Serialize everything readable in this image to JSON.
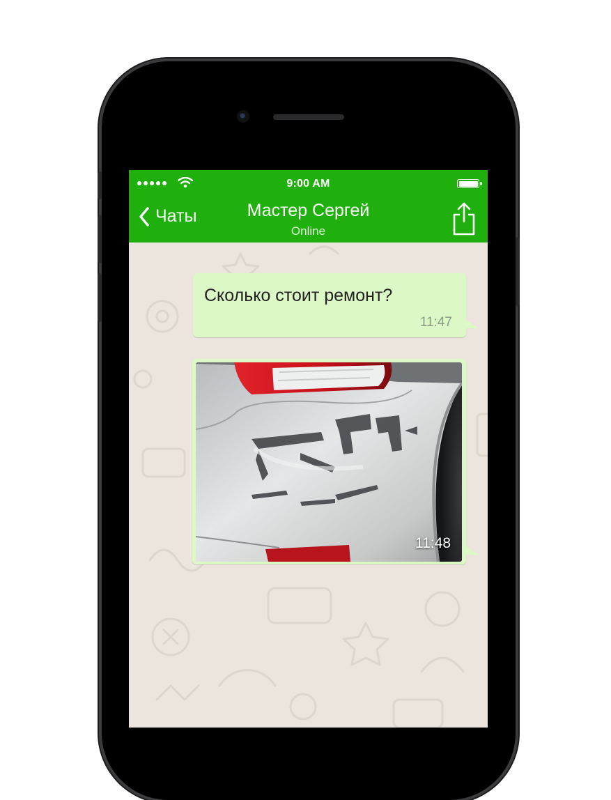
{
  "status_bar": {
    "time": "9:00 AM",
    "signal_icon": "signal-dots-icon",
    "wifi_icon": "wifi-icon",
    "battery_icon": "battery-full-icon"
  },
  "header": {
    "back_label": "Чаты",
    "back_icon": "chevron-left-icon",
    "contact_name": "Мастер Сергей",
    "contact_status": "Online",
    "share_icon": "share-icon"
  },
  "messages": [
    {
      "text": "Сколько стоит ремонт?",
      "time": "11:47"
    },
    {
      "image": "damaged-car-bumper-photo",
      "time": "11:48"
    }
  ],
  "colors": {
    "header": "#1fb00d",
    "bubble_out": "#dcf8c6",
    "chat_background": "#ece5dd"
  }
}
